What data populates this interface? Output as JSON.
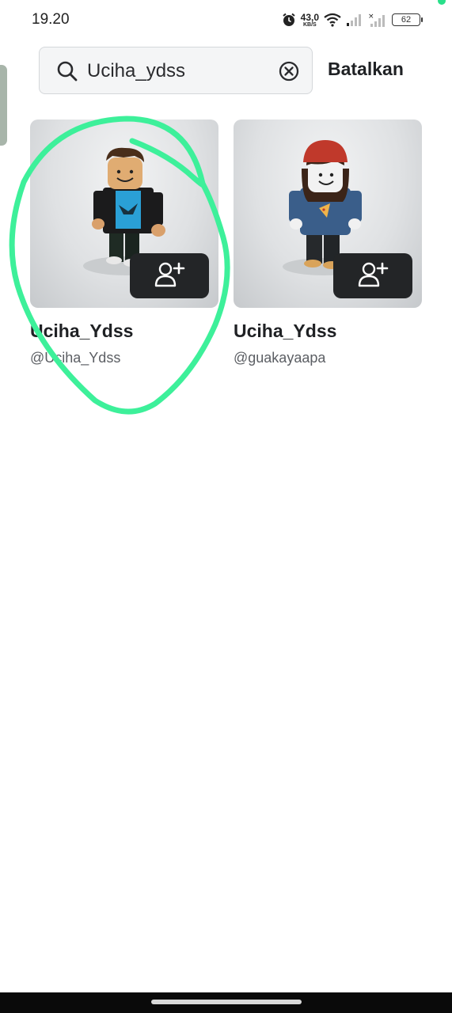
{
  "status_bar": {
    "time": "19.20",
    "net_speed": "43,0",
    "net_unit": "KB/S",
    "battery": "62",
    "icons": [
      "alarm-icon",
      "wifi-icon",
      "signal-icon",
      "signal-no-sim-icon",
      "battery-icon"
    ]
  },
  "search": {
    "query": "Uciha_ydss",
    "search_icon": "search-icon",
    "clear_icon": "clear-icon"
  },
  "cancel_label": "Batalkan",
  "results": [
    {
      "display_name": "Uciha_Ydss",
      "username": "@Uciha_Ydss",
      "action_icon": "add-friend-icon"
    },
    {
      "display_name": "Uciha_Ydss",
      "username": "@guakayaapa",
      "action_icon": "add-friend-icon"
    }
  ],
  "colors": {
    "highlight": "#3df09a",
    "button_bg": "#232527",
    "text_primary": "#1f2124",
    "text_secondary": "#5b5e63"
  }
}
